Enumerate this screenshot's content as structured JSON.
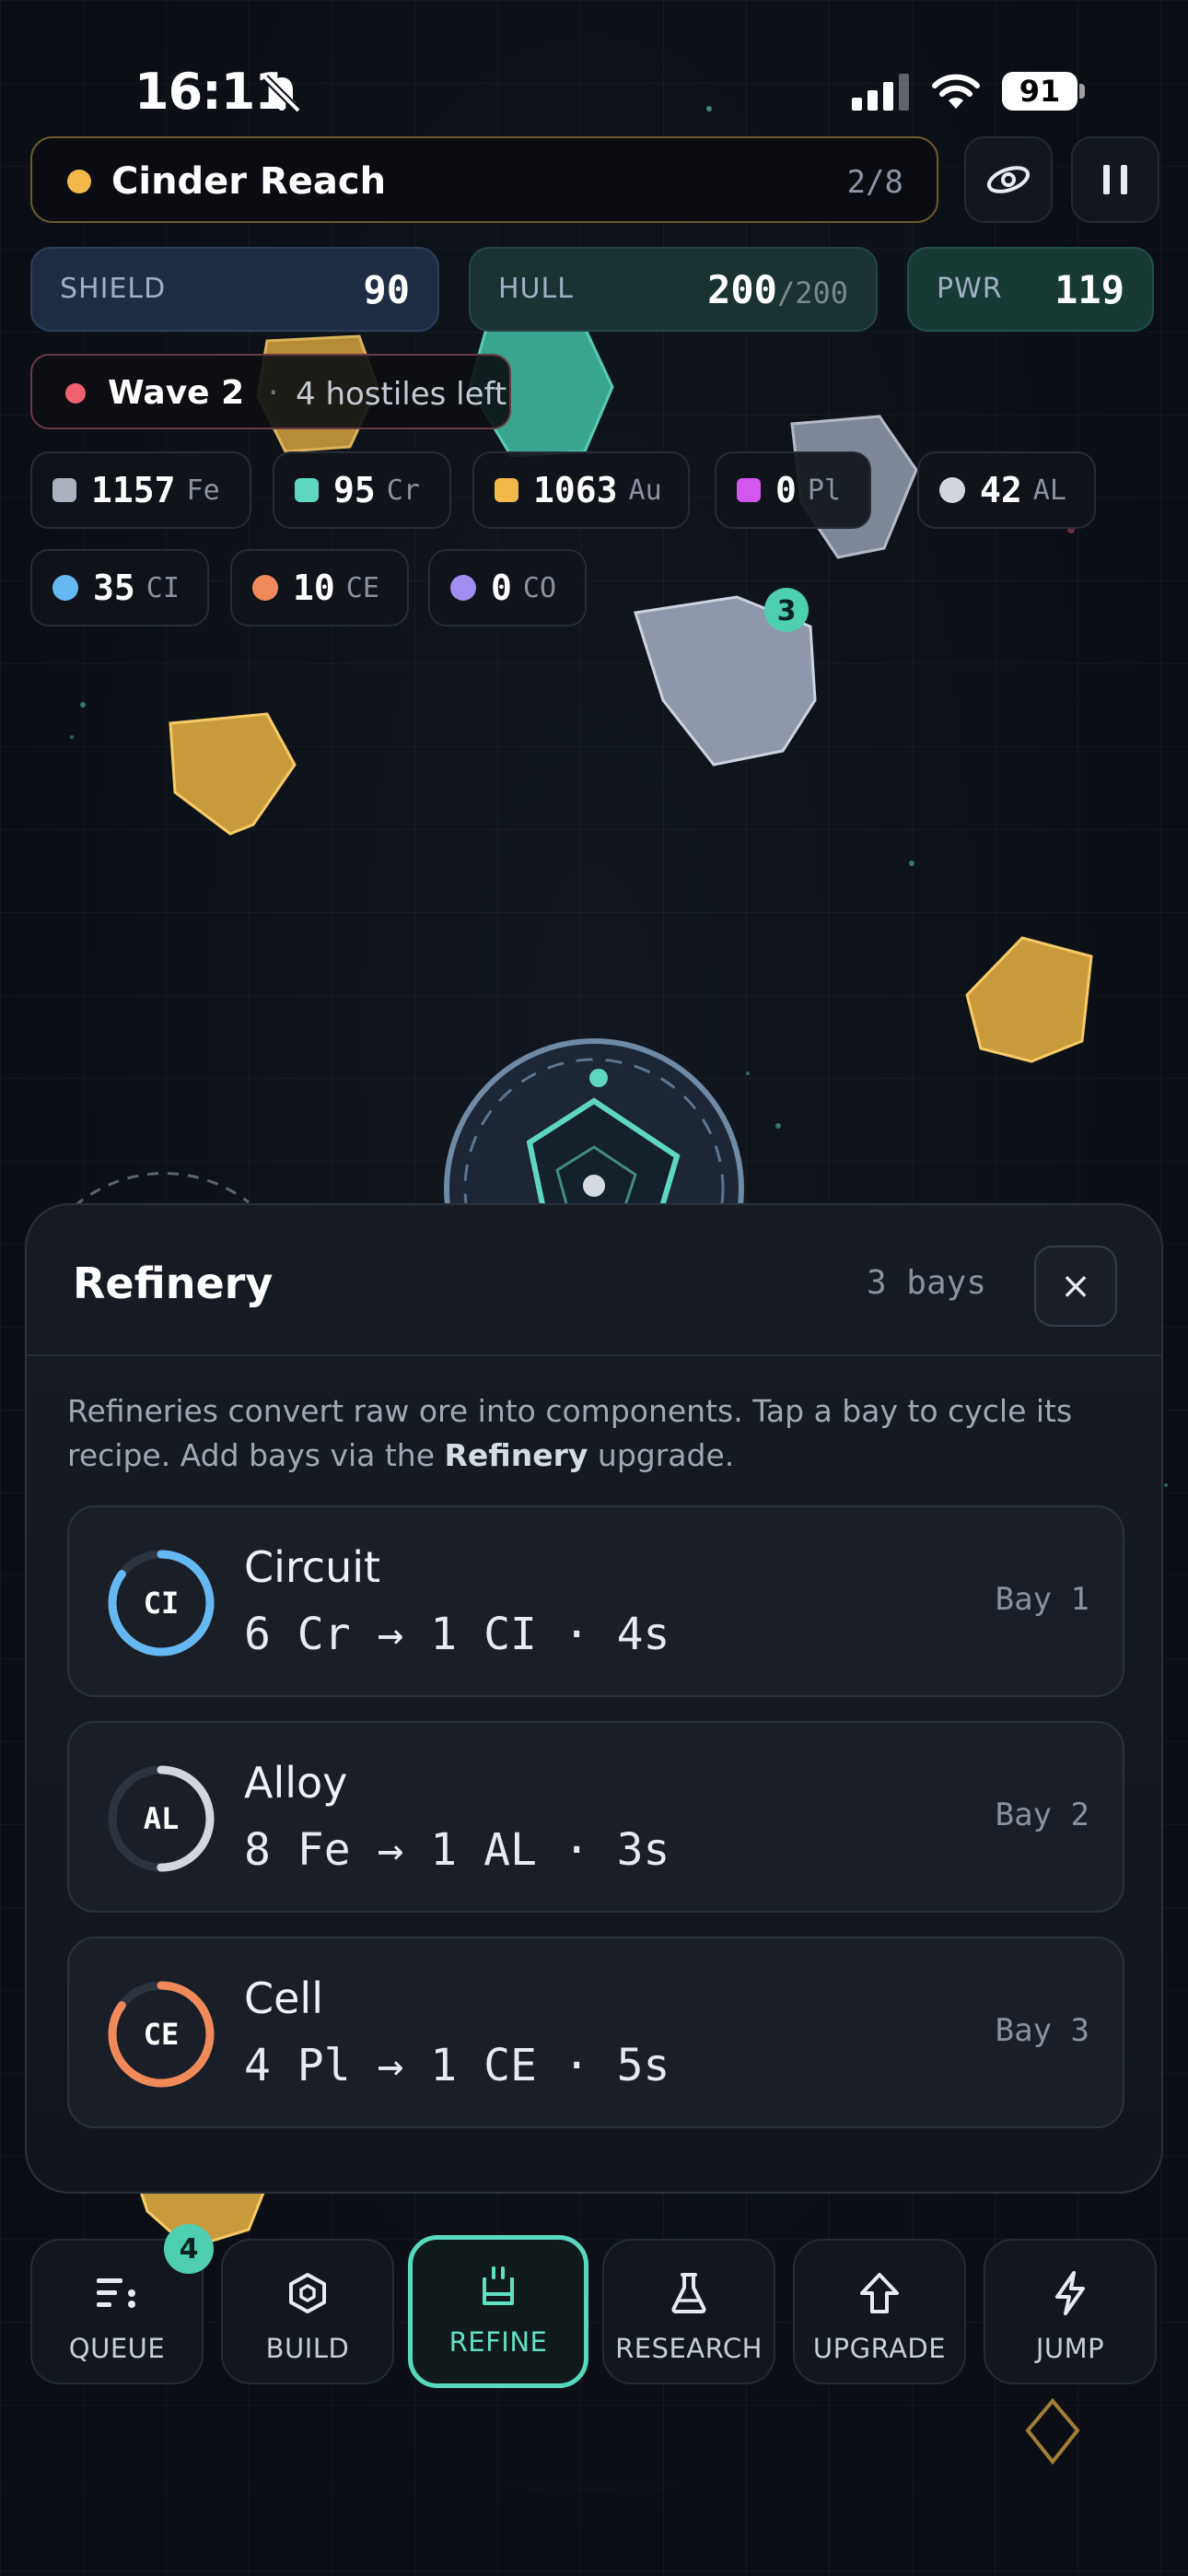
{
  "status_bar": {
    "time": "16:11",
    "battery": "91"
  },
  "location": {
    "name": "Cinder Reach",
    "progress": "2/8"
  },
  "stats": {
    "shield": {
      "label": "SHIELD",
      "value": "90"
    },
    "hull": {
      "label": "HULL",
      "value": "200",
      "max": "/200"
    },
    "power": {
      "label": "PWR",
      "value": "119"
    }
  },
  "wave": {
    "title": "Wave 2",
    "separator": "·",
    "subtitle": "4 hostiles left"
  },
  "resources": [
    {
      "value": "1157",
      "symbol": "Fe",
      "color": "#a9b1bf",
      "shape": "square"
    },
    {
      "value": "95",
      "symbol": "Cr",
      "color": "#5fd6c0",
      "shape": "square"
    },
    {
      "value": "1063",
      "symbol": "Au",
      "color": "#f2b94a",
      "shape": "square"
    },
    {
      "value": "0",
      "symbol": "Pl",
      "color": "#d357ee",
      "shape": "square"
    },
    {
      "value": "42",
      "symbol": "AL",
      "color": "#d2d7de",
      "shape": "circle"
    },
    {
      "value": "35",
      "symbol": "CI",
      "color": "#66b8f2",
      "shape": "circle"
    },
    {
      "value": "10",
      "symbol": "CE",
      "color": "#f08a5a",
      "shape": "circle"
    },
    {
      "value": "0",
      "symbol": "CO",
      "color": "#a28df0",
      "shape": "circle"
    }
  ],
  "field": {
    "asteroid_badge": "3"
  },
  "refinery": {
    "title": "Refinery",
    "bay_count": "3 bays",
    "close_icon": "×",
    "desc_before": "Refineries convert raw ore into components. Tap a bay to cycle its recipe. Add bays via the ",
    "desc_bold": "Refinery",
    "desc_after": " upgrade.",
    "bays": [
      {
        "abbr": "CI",
        "name": "Circuit",
        "recipe": "6 Cr → 1 CI · 4s",
        "bay": "Bay 1",
        "color": "#66b8f2",
        "progress": 0.85
      },
      {
        "abbr": "AL",
        "name": "Alloy",
        "recipe": "8 Fe → 1 AL · 3s",
        "bay": "Bay 2",
        "color": "#d2d7de",
        "progress": 0.5
      },
      {
        "abbr": "CE",
        "name": "Cell",
        "recipe": "4 Pl → 1 CE · 5s",
        "bay": "Bay 3",
        "color": "#f08a5a",
        "progress": 0.85
      }
    ]
  },
  "nav": {
    "queue_badge": "4",
    "items": [
      {
        "label": "QUEUE",
        "icon": "queue-icon"
      },
      {
        "label": "BUILD",
        "icon": "hexagon-icon"
      },
      {
        "label": "REFINE",
        "icon": "refine-icon"
      },
      {
        "label": "RESEARCH",
        "icon": "flask-icon"
      },
      {
        "label": "UPGRADE",
        "icon": "arrow-up-icon"
      },
      {
        "label": "JUMP",
        "icon": "bolt-icon"
      }
    ],
    "active": "REFINE"
  }
}
